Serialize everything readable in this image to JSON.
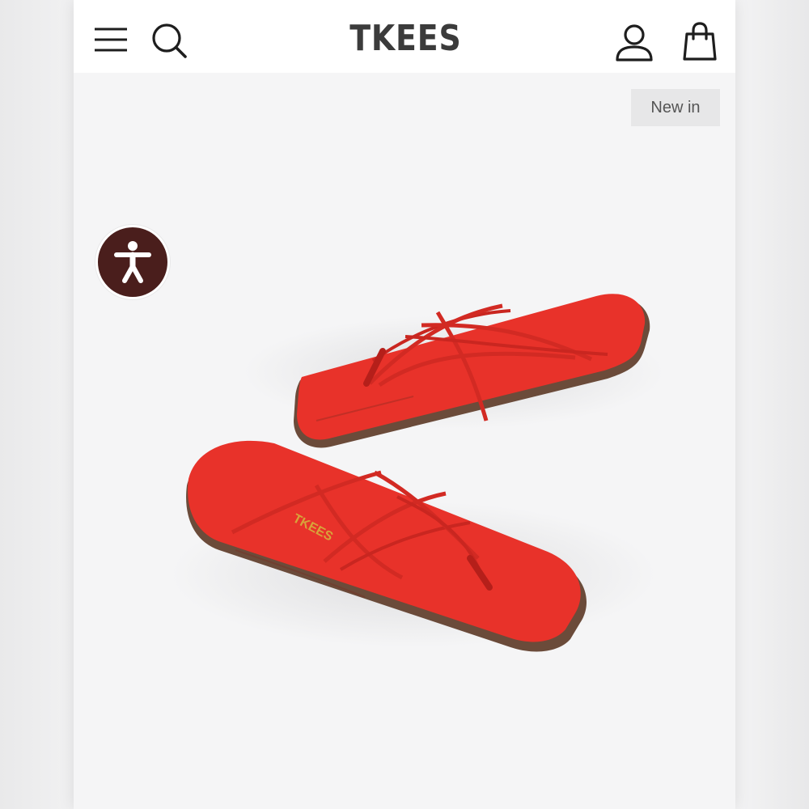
{
  "header": {
    "brand": "TKEES",
    "menu_icon": "hamburger-menu-icon",
    "search_icon": "search-icon",
    "account_icon": "user-account-icon",
    "bag_icon": "shopping-bag-icon"
  },
  "product": {
    "badge": "New in",
    "sole_brand_text": "TKEES",
    "color": "#e8322a"
  },
  "accessibility": {
    "icon": "accessibility-person-icon",
    "color": "#4a1e1c"
  }
}
